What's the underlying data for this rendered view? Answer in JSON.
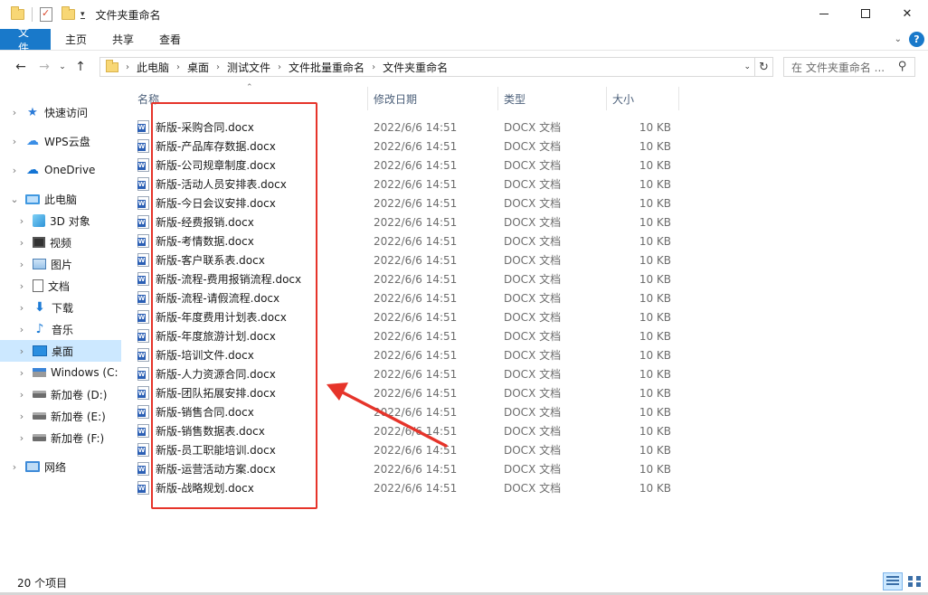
{
  "window": {
    "title": "文件夹重命名",
    "minimize_icon": "minimize-icon",
    "maximize_icon": "maximize-icon",
    "close_glyph": "✕"
  },
  "ribbon": {
    "tabs": [
      "文件",
      "主页",
      "共享",
      "查看"
    ],
    "accent_color": "#1979ca",
    "help_label": "?"
  },
  "address": {
    "breadcrumbs": [
      "此电脑",
      "桌面",
      "测试文件",
      "文件批量重命名",
      "文件夹重命名"
    ],
    "search_placeholder": "在 文件夹重命名 ..."
  },
  "sidebar": {
    "items": [
      {
        "label": "快速访问",
        "icon": "star-icon"
      },
      {
        "label": "WPS云盘",
        "icon": "cloud-icon"
      },
      {
        "label": "OneDrive",
        "icon": "onedrive-icon"
      },
      {
        "label": "此电脑",
        "icon": "computer-icon"
      },
      {
        "label": "3D 对象",
        "icon": "cube-icon"
      },
      {
        "label": "视频",
        "icon": "video-icon"
      },
      {
        "label": "图片",
        "icon": "pictures-icon"
      },
      {
        "label": "文档",
        "icon": "documents-icon"
      },
      {
        "label": "下载",
        "icon": "download-icon"
      },
      {
        "label": "音乐",
        "icon": "music-icon"
      },
      {
        "label": "桌面",
        "icon": "desktop-icon"
      },
      {
        "label": "Windows (C:",
        "icon": "windows-drive-icon"
      },
      {
        "label": "新加卷 (D:)",
        "icon": "drive-icon"
      },
      {
        "label": "新加卷 (E:)",
        "icon": "drive-icon"
      },
      {
        "label": "新加卷 (F:)",
        "icon": "drive-icon"
      },
      {
        "label": "网络",
        "icon": "network-icon"
      }
    ],
    "selected": "桌面"
  },
  "columns": {
    "name": "名称",
    "date": "修改日期",
    "type": "类型",
    "size": "大小"
  },
  "files": [
    {
      "name": "新版-采购合同.docx",
      "date": "2022/6/6 14:51",
      "type": "DOCX 文档",
      "size": "10 KB"
    },
    {
      "name": "新版-产品库存数据.docx",
      "date": "2022/6/6 14:51",
      "type": "DOCX 文档",
      "size": "10 KB"
    },
    {
      "name": "新版-公司规章制度.docx",
      "date": "2022/6/6 14:51",
      "type": "DOCX 文档",
      "size": "10 KB"
    },
    {
      "name": "新版-活动人员安排表.docx",
      "date": "2022/6/6 14:51",
      "type": "DOCX 文档",
      "size": "10 KB"
    },
    {
      "name": "新版-今日会议安排.docx",
      "date": "2022/6/6 14:51",
      "type": "DOCX 文档",
      "size": "10 KB"
    },
    {
      "name": "新版-经费报销.docx",
      "date": "2022/6/6 14:51",
      "type": "DOCX 文档",
      "size": "10 KB"
    },
    {
      "name": "新版-考情数据.docx",
      "date": "2022/6/6 14:51",
      "type": "DOCX 文档",
      "size": "10 KB"
    },
    {
      "name": "新版-客户联系表.docx",
      "date": "2022/6/6 14:51",
      "type": "DOCX 文档",
      "size": "10 KB"
    },
    {
      "name": "新版-流程-费用报销流程.docx",
      "date": "2022/6/6 14:51",
      "type": "DOCX 文档",
      "size": "10 KB"
    },
    {
      "name": "新版-流程-请假流程.docx",
      "date": "2022/6/6 14:51",
      "type": "DOCX 文档",
      "size": "10 KB"
    },
    {
      "name": "新版-年度费用计划表.docx",
      "date": "2022/6/6 14:51",
      "type": "DOCX 文档",
      "size": "10 KB"
    },
    {
      "name": "新版-年度旅游计划.docx",
      "date": "2022/6/6 14:51",
      "type": "DOCX 文档",
      "size": "10 KB"
    },
    {
      "name": "新版-培训文件.docx",
      "date": "2022/6/6 14:51",
      "type": "DOCX 文档",
      "size": "10 KB"
    },
    {
      "name": "新版-人力资源合同.docx",
      "date": "2022/6/6 14:51",
      "type": "DOCX 文档",
      "size": "10 KB"
    },
    {
      "name": "新版-团队拓展安排.docx",
      "date": "2022/6/6 14:51",
      "type": "DOCX 文档",
      "size": "10 KB"
    },
    {
      "name": "新版-销售合同.docx",
      "date": "2022/6/6 14:51",
      "type": "DOCX 文档",
      "size": "10 KB"
    },
    {
      "name": "新版-销售数据表.docx",
      "date": "2022/6/6 14:51",
      "type": "DOCX 文档",
      "size": "10 KB"
    },
    {
      "name": "新版-员工职能培训.docx",
      "date": "2022/6/6 14:51",
      "type": "DOCX 文档",
      "size": "10 KB"
    },
    {
      "name": "新版-运营活动方案.docx",
      "date": "2022/6/6 14:51",
      "type": "DOCX 文档",
      "size": "10 KB"
    },
    {
      "name": "新版-战略规划.docx",
      "date": "2022/6/6 14:51",
      "type": "DOCX 文档",
      "size": "10 KB"
    }
  ],
  "status": {
    "item_count": "20 个项目"
  },
  "annotation": {
    "color": "#e6342a"
  }
}
